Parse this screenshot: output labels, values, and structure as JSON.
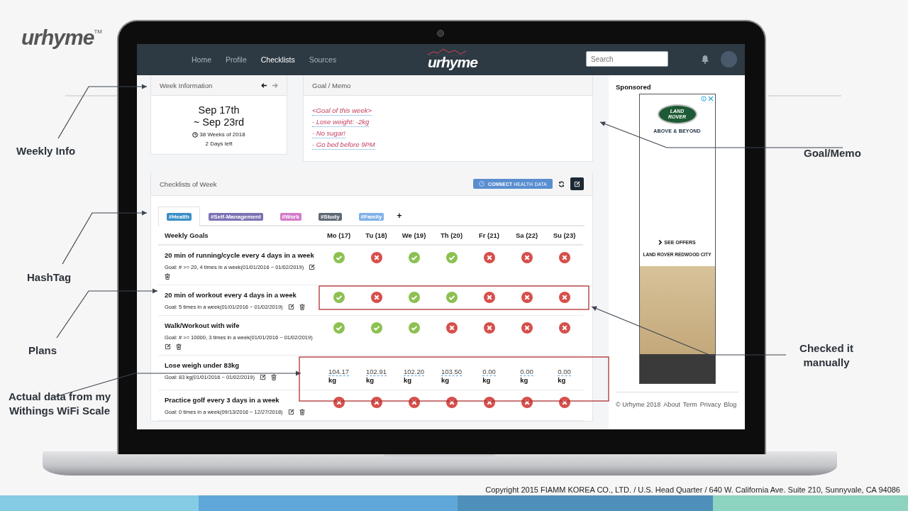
{
  "slide_logo": {
    "name": "urhyme",
    "mark": "TM"
  },
  "nav": {
    "links": [
      {
        "label": "Home",
        "selected": false
      },
      {
        "label": "Profile",
        "selected": false
      },
      {
        "label": "Checklists",
        "selected": true
      },
      {
        "label": "Sources",
        "selected": false
      }
    ],
    "logo": "urhyme",
    "search": {
      "placeholder": "Search"
    }
  },
  "week_info": {
    "title": "Week Information",
    "range_start": "Sep 17th",
    "range_end": "~ Sep 23rd",
    "weeks": "38 Weeks of 2018",
    "days_left": "2 Days left"
  },
  "goal_memo": {
    "title": "Goal / Memo",
    "lines": [
      "<Goal of this week>",
      "- Lose weight: -2kg",
      "- No sugar!",
      "- Go bed before 9PM"
    ]
  },
  "checklists": {
    "title": "Checklists of Week",
    "connect_button": "**CONNECT** HEALTH DATA",
    "tabs": [
      {
        "label": "#Health",
        "color": "#3a8fc6",
        "selected": true
      },
      {
        "label": "#Self-Management",
        "color": "#7b72b3",
        "selected": false
      },
      {
        "label": "#Work",
        "color": "#d47bcb",
        "selected": false
      },
      {
        "label": "#Study",
        "color": "#5f6874",
        "selected": false
      },
      {
        "label": "#Family",
        "color": "#7fb0e8",
        "selected": false
      }
    ],
    "add_tab": "+",
    "columns": [
      "Weekly Goals",
      "Mo (17)",
      "Tu (18)",
      "We (19)",
      "Th (20)",
      "Fr (21)",
      "Sa (22)",
      "Su (23)"
    ],
    "rows": [
      {
        "kind": "check",
        "title": "20 min of running/cycle every 4 days in a week",
        "goal": "Goal: # >= 20, 4 times in a week(01/01/2016 ~ 01/02/2019)",
        "days": [
          {
            "checked": true
          },
          {
            "checked": false
          },
          {
            "checked": true
          },
          {
            "checked": true
          },
          {
            "checked": false
          },
          {
            "checked": false
          },
          {
            "checked": false
          }
        ]
      },
      {
        "kind": "check",
        "title": "20 min of workout every 4 days in a week",
        "goal": "Goal: 5 times in a week(01/01/2016 ~ 01/02/2019)",
        "days": [
          {
            "checked": true
          },
          {
            "checked": false
          },
          {
            "checked": true
          },
          {
            "checked": true
          },
          {
            "checked": false
          },
          {
            "checked": false
          },
          {
            "checked": false
          }
        ]
      },
      {
        "kind": "check",
        "title": "Walk/Workout with wife",
        "goal": "Goal: # >= 10000, 3 times in a week(01/01/2016 ~ 01/02/2019)",
        "days": [
          {
            "checked": true
          },
          {
            "checked": true
          },
          {
            "checked": true
          },
          {
            "checked": false
          },
          {
            "checked": false
          },
          {
            "checked": false
          },
          {
            "checked": false
          }
        ]
      },
      {
        "kind": "measure",
        "title": "Lose weigh under 83kg",
        "goal": "Goal: 83 kg(01/01/2016 ~ 01/02/2019)",
        "days": [
          {
            "value": "104.17",
            "unit": "kg"
          },
          {
            "value": "102.91",
            "unit": "kg"
          },
          {
            "value": "102.20",
            "unit": "kg"
          },
          {
            "value": "103.50",
            "unit": "kg"
          },
          {
            "value": "0.00",
            "unit": "kg"
          },
          {
            "value": "0.00",
            "unit": "kg"
          },
          {
            "value": "0.00",
            "unit": "kg"
          }
        ]
      },
      {
        "kind": "check",
        "title": "Practice golf every 3 days in a week",
        "goal": "Goal: 0 times in a week(09/13/2016 ~ 12/27/2018)",
        "days": [
          {
            "checked": false
          },
          {
            "checked": false
          },
          {
            "checked": false
          },
          {
            "checked": false
          },
          {
            "checked": false
          },
          {
            "checked": false
          },
          {
            "checked": false
          }
        ]
      }
    ]
  },
  "sidebar": {
    "title": "Sponsored",
    "ad": {
      "logo_top": "LAND",
      "logo_bottom": "ROVER",
      "tagline": "ABOVE & BEYOND",
      "cta": "SEE OFFERS",
      "dealer": "LAND ROVER REDWOOD CITY"
    },
    "footer": {
      "copyright": "© Urhyme 2018",
      "links": [
        "About",
        "Term",
        "Privacy",
        "Blog"
      ]
    }
  },
  "callouts": [
    "Weekly Info",
    "HashTag",
    "Plans",
    "Actual data from my Withings WiFi Scale",
    "Goal/Memo",
    "Checked it manually"
  ],
  "copyright": "Copyright 2015 FIAMM KOREA CO., LTD. / U.S. Head Quarter / 640 W. California Ave. Suite 210, Sunnyvale, CA 94086"
}
